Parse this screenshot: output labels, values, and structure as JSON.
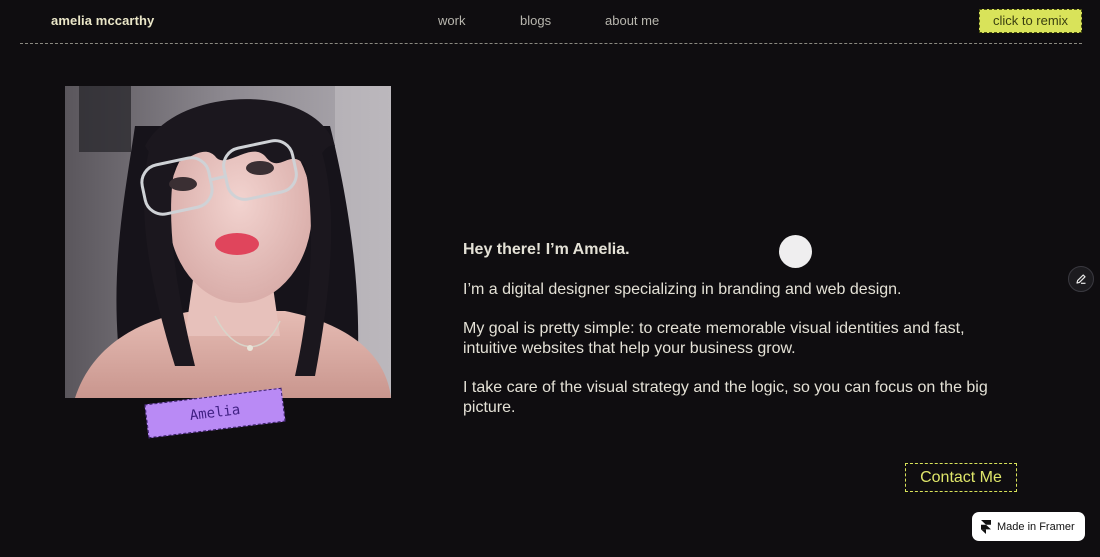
{
  "header": {
    "brand": "amelia mccarthy",
    "nav": [
      {
        "label": "work"
      },
      {
        "label": "blogs"
      },
      {
        "label": "about me"
      }
    ],
    "remix_button": "click to remix"
  },
  "profile": {
    "name_tag": "Amelia"
  },
  "bio": {
    "greeting": "Hey there! I’m Amelia.",
    "paragraph_1": "I’m a digital designer specializing in branding and web design.",
    "paragraph_2": "My goal is pretty simple: to create memorable visual identities and fast, intuitive websites that help your business grow.",
    "paragraph_3": " I take care of the visual strategy and the logic, so you can focus on the big picture."
  },
  "cta": {
    "contact_label": "Contact Me"
  },
  "badge": {
    "framer_label": "Made in Framer"
  },
  "icons": {
    "edit": "pencil-icon",
    "framer": "framer-logo-icon"
  },
  "colors": {
    "background": "#0f0d10",
    "accent_lime": "#d9e35a",
    "tag_purple": "#b98af5",
    "text": "#e4e1d6"
  }
}
